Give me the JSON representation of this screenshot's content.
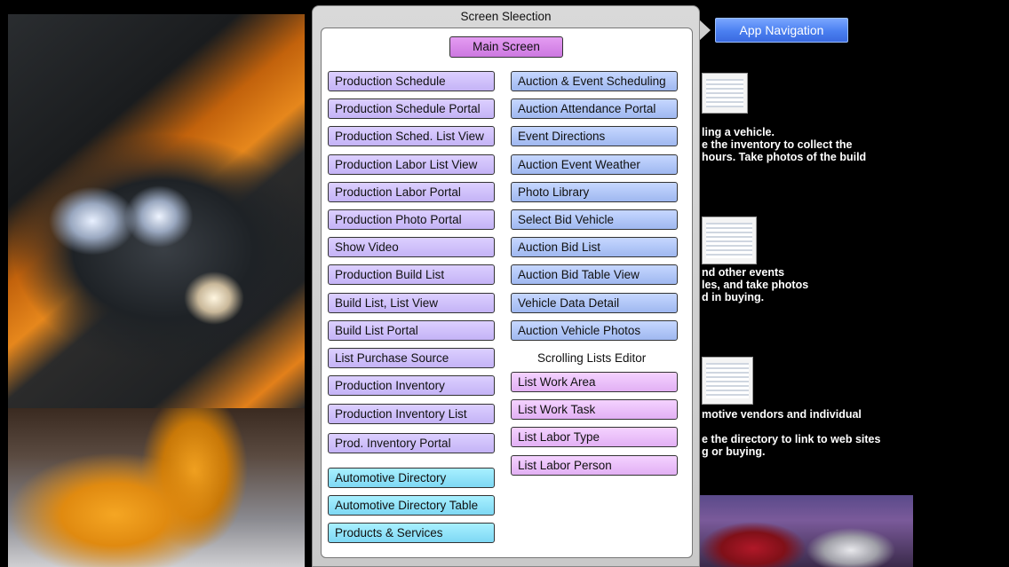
{
  "popup": {
    "title": "Screen Sleection",
    "main_screen": "Main Screen",
    "left_buttons": [
      {
        "label": "Production Schedule",
        "color": "purple"
      },
      {
        "label": "Production Schedule Portal",
        "color": "purple"
      },
      {
        "label": "Production Sched. List View",
        "color": "purple"
      },
      {
        "label": "Production Labor List View",
        "color": "purple"
      },
      {
        "label": "Production Labor Portal",
        "color": "purple"
      },
      {
        "label": "Production Photo Portal",
        "color": "purple"
      },
      {
        "label": "Show Video",
        "color": "purple"
      },
      {
        "label": "Production Build List",
        "color": "purple"
      },
      {
        "label": "Build List, List View",
        "color": "purple"
      },
      {
        "label": "Build List Portal",
        "color": "purple"
      },
      {
        "label": "List Purchase Source",
        "color": "purple"
      },
      {
        "label": "Production Inventory",
        "color": "purple"
      },
      {
        "label": "Production Inventory List",
        "color": "purple"
      },
      {
        "label": "Prod. Inventory Portal",
        "color": "purple"
      },
      {
        "label": "Automotive Directory",
        "color": "cyan"
      },
      {
        "label": "Automotive Directory Table",
        "color": "cyan"
      },
      {
        "label": "Products & Services",
        "color": "cyan"
      }
    ],
    "right_buttons": [
      {
        "label": "Auction & Event Scheduling",
        "color": "blue"
      },
      {
        "label": "Auction Attendance Portal",
        "color": "blue"
      },
      {
        "label": "Event Directions",
        "color": "blue"
      },
      {
        "label": "Auction Event Weather",
        "color": "blue"
      },
      {
        "label": "Photo Library",
        "color": "blue"
      },
      {
        "label": "Select Bid Vehicle",
        "color": "blue"
      },
      {
        "label": "Auction Bid List",
        "color": "blue"
      },
      {
        "label": "Auction Bid Table View",
        "color": "blue"
      },
      {
        "label": "Vehicle Data Detail",
        "color": "blue"
      },
      {
        "label": "Auction Vehicle Photos",
        "color": "blue"
      }
    ],
    "scrolling_lists_label": "Scrolling Lists Editor",
    "list_buttons": [
      {
        "label": "List Work Area",
        "color": "pink"
      },
      {
        "label": "List Work Task",
        "color": "pink"
      },
      {
        "label": "List Labor Type",
        "color": "pink"
      },
      {
        "label": "List Labor Person",
        "color": "pink"
      }
    ]
  },
  "app_nav": {
    "label": "App Navigation"
  },
  "background_text": {
    "block1": "ling a vehicle.\ne the inventory to collect the\nhours. Take photos of the build",
    "block2": "nd other events\nles, and take photos\nd in buying.",
    "block3": "motive vendors and individual\n\ne the directory to link to web sites\ng or buying."
  },
  "colors": {
    "purple": "#c4b3f6",
    "blue": "#9fb8f0",
    "pink": "#e2b0f4",
    "cyan": "#7ed8f4",
    "magenta": "#cc78e0",
    "app_nav": "#4a7ff0"
  }
}
